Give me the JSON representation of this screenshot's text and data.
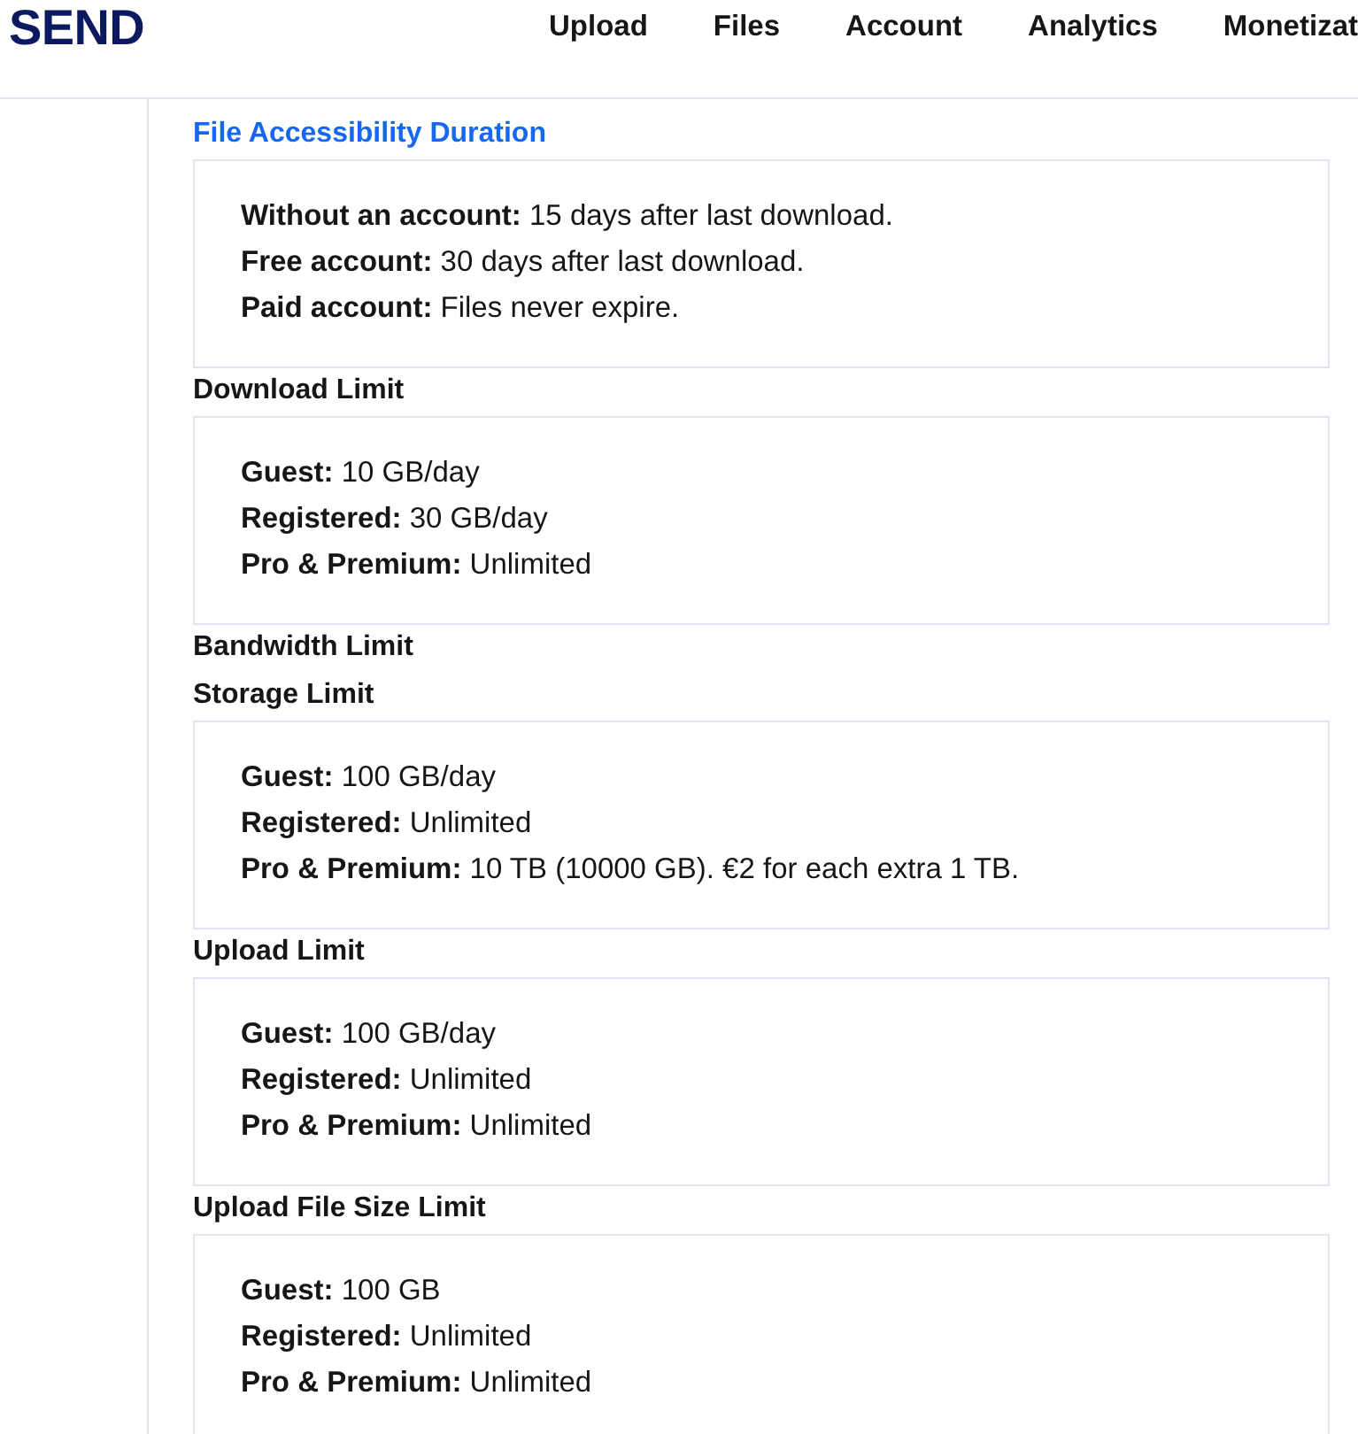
{
  "header": {
    "logo": "SEND",
    "nav": [
      {
        "label": "Upload"
      },
      {
        "label": "Files"
      },
      {
        "label": "Account"
      },
      {
        "label": "Analytics"
      },
      {
        "label": "Monetizat"
      }
    ]
  },
  "sections": [
    {
      "title": "File Accessibility Duration",
      "kind": "link",
      "lines": [
        "**Without an account:** 15 days after last download.",
        "**Free account:** 30 days after last download.",
        "**Paid account:** Files never expire."
      ]
    },
    {
      "title": "Download Limit",
      "kind": "heading",
      "lines": [
        "**Guest:** 10 GB/day",
        "**Registered:** 30 GB/day",
        "**Pro & Premium:** Unlimited"
      ]
    },
    {
      "title": "Bandwidth Limit",
      "kind": "heading"
    },
    {
      "title": "Storage Limit",
      "kind": "heading",
      "lines": [
        "**Guest:** 100 GB/day",
        "**Registered:** Unlimited",
        "**Pro & Premium:** 10 TB (10000 GB). €2 for each extra 1 TB."
      ]
    },
    {
      "title": "Upload Limit",
      "kind": "heading",
      "lines": [
        "**Guest:** 100 GB/day",
        "**Registered:** Unlimited",
        "**Pro & Premium:** Unlimited"
      ]
    },
    {
      "title": "Upload File Size Limit",
      "kind": "heading",
      "lines": [
        "**Guest:** 100 GB",
        "**Registered:** Unlimited",
        "**Pro & Premium:** Unlimited"
      ]
    }
  ]
}
